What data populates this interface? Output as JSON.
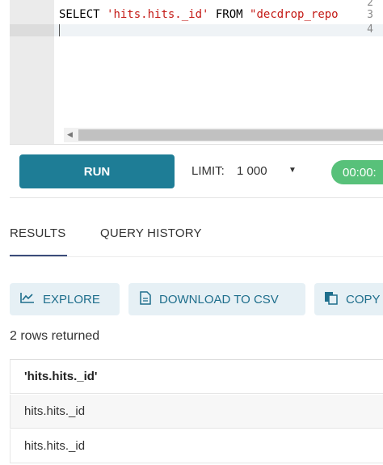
{
  "editor": {
    "line_numbers": [
      "2",
      "3",
      "4"
    ],
    "code": {
      "keyword_select": "SELECT ",
      "string_field": "'hits.hits._id'",
      "keyword_from": " FROM ",
      "string_table": "\"decdrop_repo"
    }
  },
  "toolbar": {
    "run_label": "RUN",
    "limit_label": "LIMIT:",
    "limit_value": "1 000",
    "timer_text": "00:00:"
  },
  "tabs": [
    {
      "label": "RESULTS",
      "active": true
    },
    {
      "label": "QUERY HISTORY",
      "active": false
    }
  ],
  "actions": {
    "explore_label": "EXPLORE",
    "download_label": "DOWNLOAD TO CSV",
    "copy_label": "COPY"
  },
  "results": {
    "summary": "2 rows returned",
    "columns": [
      "'hits.hits._id'"
    ],
    "rows": [
      [
        "hits.hits._id"
      ],
      [
        "hits.hits._id"
      ]
    ]
  },
  "colors": {
    "run_button": "#1e7d96",
    "timer_badge": "#58c17a",
    "action_bg": "#e6f0f5",
    "action_text": "#1e6e8c",
    "sql_string": "#c41a16"
  },
  "icons": {
    "explore": "line-chart-icon",
    "download": "document-icon",
    "copy": "copy-icon",
    "limit_dropdown": "caret-down-icon"
  }
}
